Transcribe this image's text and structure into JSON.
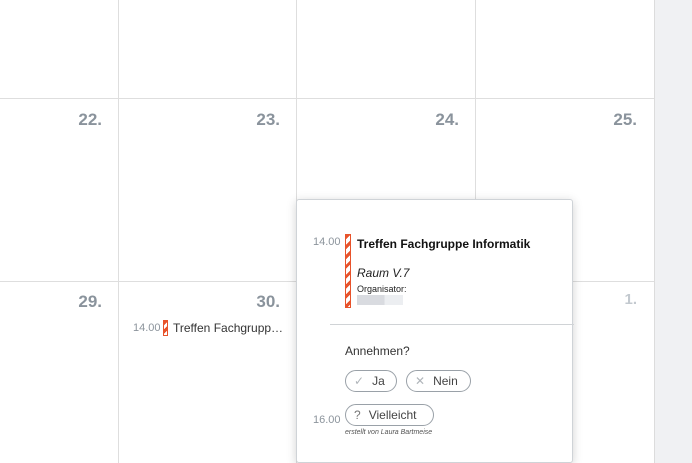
{
  "calendar": {
    "days": [
      {
        "label": "22."
      },
      {
        "label": "23."
      },
      {
        "label": "24."
      },
      {
        "label": "25."
      },
      {
        "label": "29."
      },
      {
        "label": "30."
      },
      {
        "label": "1."
      }
    ],
    "event": {
      "time": "14.00",
      "title": "Treffen Fachgruppe Informatik",
      "title_truncated": "Treffen Fachgrupp…"
    }
  },
  "popup": {
    "time": "14.00",
    "title": "Treffen Fachgruppe Informatik",
    "room": "Raum V.7",
    "organizer_label": "Organisator:",
    "question": "Annehmen?",
    "accept_label": "Ja",
    "decline_label": "Nein",
    "maybe_label": "Vielleicht",
    "end_time": "16.00",
    "created_by": "erstellt von Laura Bartmeise"
  },
  "icons": {
    "accept": "checkmark-icon",
    "decline": "cross-icon",
    "maybe": "question-icon"
  },
  "colors": {
    "event_stripe": "#e8532b",
    "day_number": "#8a939c"
  }
}
